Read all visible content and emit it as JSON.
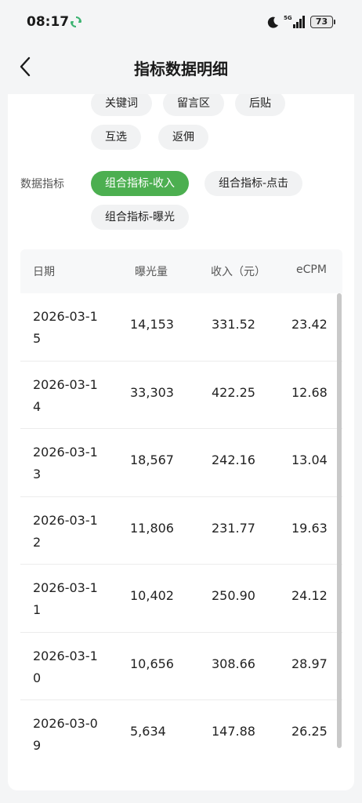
{
  "status": {
    "time": "08:17",
    "battery": "73"
  },
  "nav": {
    "title": "指标数据明细"
  },
  "filters": {
    "chips_row1": [
      "关键词",
      "留言区",
      "后贴"
    ],
    "chips_row2": [
      "互选",
      "返佣"
    ],
    "metric_label": "数据指标",
    "metric_chips": [
      "组合指标-收入",
      "组合指标-点击",
      "组合指标-曝光"
    ]
  },
  "table": {
    "headers": [
      "日期",
      "曝光量",
      "收入（元）",
      "eCPM"
    ],
    "rows": [
      [
        "2026-03-15",
        "14,153",
        "331.52",
        "23.42"
      ],
      [
        "2026-03-14",
        "33,303",
        "422.25",
        "12.68"
      ],
      [
        "2026-03-13",
        "18,567",
        "242.16",
        "13.04"
      ],
      [
        "2026-03-12",
        "11,806",
        "231.77",
        "19.63"
      ],
      [
        "2026-03-11",
        "10,402",
        "250.90",
        "24.12"
      ],
      [
        "2026-03-10",
        "10,656",
        "308.66",
        "28.97"
      ],
      [
        "2026-03-09",
        "5,634",
        "147.88",
        "26.25"
      ]
    ]
  },
  "colors": {
    "accent": "#4caf50"
  }
}
